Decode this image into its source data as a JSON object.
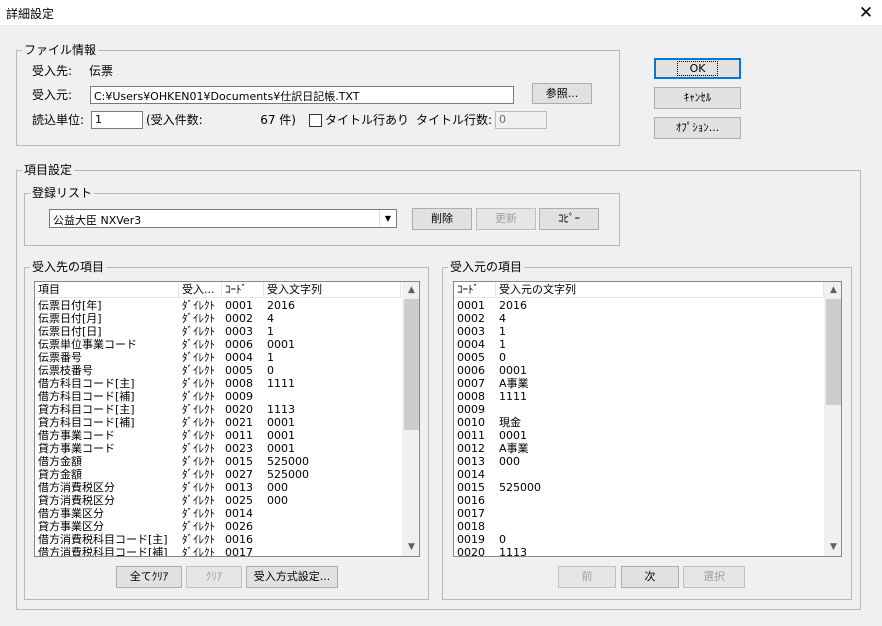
{
  "window": {
    "title": "詳細設定",
    "close_glyph": "✕"
  },
  "file_info": {
    "group_label": "ファイル情報",
    "dest_label": "受入先:",
    "dest_value": "伝票",
    "source_label": "受入元:",
    "source_path": "C:¥Users¥OHKEN01¥Documents¥仕訳日記帳.TXT",
    "browse_button": "参照...",
    "unit_label": "読込単位:",
    "unit_value": "1",
    "count_label": "(受入件数:",
    "count_value": "67 件)",
    "title_row_label": "タイトル行あり",
    "title_rows_label": "タイトル行数:",
    "title_rows_value": "0"
  },
  "dialog_buttons": {
    "ok": "OK",
    "cancel": "ｷｬﾝｾﾙ",
    "options": "ｵﾌﾟｼｮﾝ..."
  },
  "item_settings": {
    "group_label": "項目設定",
    "registry_label": "登録リスト",
    "registry_value": "公益大臣 NXVer3",
    "delete_button": "削除",
    "update_button": "更新",
    "copy_button": "ｺﾋﾟｰ"
  },
  "dest_items": {
    "group_label": "受入先の項目",
    "columns": [
      "項目",
      "受入...",
      "ｺｰﾄﾞ",
      "受入文字列"
    ],
    "rows": [
      [
        "伝票日付[年]",
        "ﾀﾞｲﾚｸﾄ",
        "0001",
        "2016"
      ],
      [
        "伝票日付[月]",
        "ﾀﾞｲﾚｸﾄ",
        "0002",
        "4"
      ],
      [
        "伝票日付[日]",
        "ﾀﾞｲﾚｸﾄ",
        "0003",
        "1"
      ],
      [
        "伝票単位事業コード",
        "ﾀﾞｲﾚｸﾄ",
        "0006",
        "0001"
      ],
      [
        "伝票番号",
        "ﾀﾞｲﾚｸﾄ",
        "0004",
        "1"
      ],
      [
        "伝票枝番号",
        "ﾀﾞｲﾚｸﾄ",
        "0005",
        "0"
      ],
      [
        "借方科目コード[主]",
        "ﾀﾞｲﾚｸﾄ",
        "0008",
        "1111"
      ],
      [
        "借方科目コード[補]",
        "ﾀﾞｲﾚｸﾄ",
        "0009",
        ""
      ],
      [
        "貸方科目コード[主]",
        "ﾀﾞｲﾚｸﾄ",
        "0020",
        "1113"
      ],
      [
        "貸方科目コード[補]",
        "ﾀﾞｲﾚｸﾄ",
        "0021",
        "0001"
      ],
      [
        "借方事業コード",
        "ﾀﾞｲﾚｸﾄ",
        "0011",
        "0001"
      ],
      [
        "貸方事業コード",
        "ﾀﾞｲﾚｸﾄ",
        "0023",
        "0001"
      ],
      [
        "借方金額",
        "ﾀﾞｲﾚｸﾄ",
        "0015",
        "525000"
      ],
      [
        "貸方金額",
        "ﾀﾞｲﾚｸﾄ",
        "0027",
        "525000"
      ],
      [
        "借方消費税区分",
        "ﾀﾞｲﾚｸﾄ",
        "0013",
        "000"
      ],
      [
        "貸方消費税区分",
        "ﾀﾞｲﾚｸﾄ",
        "0025",
        "000"
      ],
      [
        "借方事業区分",
        "ﾀﾞｲﾚｸﾄ",
        "0014",
        ""
      ],
      [
        "貸方事業区分",
        "ﾀﾞｲﾚｸﾄ",
        "0026",
        ""
      ],
      [
        "借方消費税科目コード[主]",
        "ﾀﾞｲﾚｸﾄ",
        "0016",
        ""
      ],
      [
        "借方消費税科目コード[補]",
        "ﾀﾞｲﾚｸﾄ",
        "0017",
        ""
      ]
    ],
    "clear_all_button": "全てｸﾘｱ",
    "clear_button": "ｸﾘｱ",
    "method_button": "受入方式設定..."
  },
  "source_items": {
    "group_label": "受入元の項目",
    "columns": [
      "ｺｰﾄﾞ",
      "受入元の文字列"
    ],
    "rows": [
      [
        "0001",
        "2016"
      ],
      [
        "0002",
        "4"
      ],
      [
        "0003",
        "1"
      ],
      [
        "0004",
        "1"
      ],
      [
        "0005",
        "0"
      ],
      [
        "0006",
        "0001"
      ],
      [
        "0007",
        "A事業"
      ],
      [
        "0008",
        "1111"
      ],
      [
        "0009",
        ""
      ],
      [
        "0010",
        "現金"
      ],
      [
        "0011",
        "0001"
      ],
      [
        "0012",
        "A事業"
      ],
      [
        "0013",
        "000"
      ],
      [
        "0014",
        ""
      ],
      [
        "0015",
        "525000"
      ],
      [
        "0016",
        ""
      ],
      [
        "0017",
        ""
      ],
      [
        "0018",
        ""
      ],
      [
        "0019",
        "0"
      ],
      [
        "0020",
        "1113"
      ]
    ],
    "prev_button": "前",
    "next_button": "次",
    "select_button": "選択"
  },
  "scroll": {
    "up_glyph": "▲",
    "down_glyph": "▼",
    "dropdown_glyph": "▼"
  }
}
